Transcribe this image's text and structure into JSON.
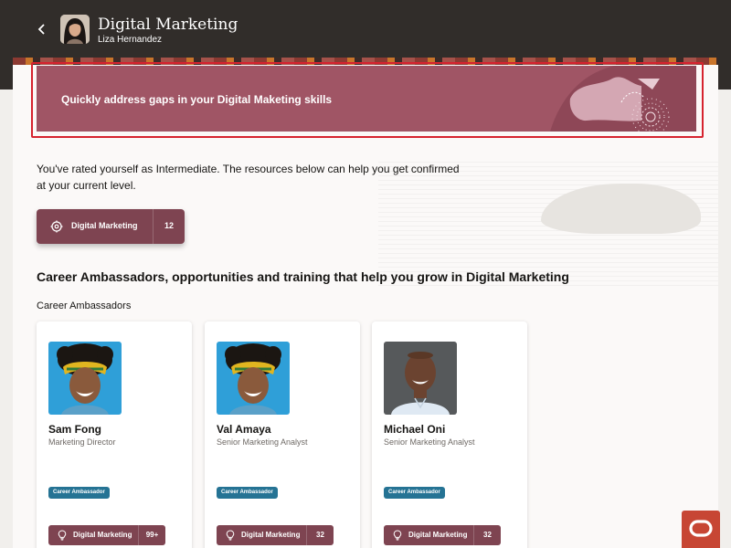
{
  "header": {
    "back_icon": "chevron-left-icon",
    "title": "Digital Marketing",
    "subtitle": "Liza Hernandez"
  },
  "banner": {
    "text": "Quickly address gaps in your Digital Maketing skills",
    "color": "#a05565"
  },
  "intro": {
    "text": "You've rated yourself as Intermediate. The resources below can help you get confirmed at your current level."
  },
  "skill_button": {
    "icon": "gear-icon",
    "label": "Digital Marketing",
    "count": "12"
  },
  "section": {
    "title": "Career Ambassadors, opportunities and training that help you grow in Digital Marketing",
    "subtitle": "Career Ambassadors"
  },
  "cards": [
    {
      "name": "Sam Fong",
      "role": "Marketing Director",
      "badge": "Career Ambassador",
      "chip_label": "Digital Marketing",
      "chip_count": "99+",
      "chip_icon": "lightbulb-icon"
    },
    {
      "name": "Val Amaya",
      "role": "Senior Marketing Analyst",
      "badge": "Career Ambassador",
      "chip_label": "Digital Marketing",
      "chip_count": "32",
      "chip_icon": "lightbulb-icon"
    },
    {
      "name": "Michael Oni",
      "role": "Senior Marketing Analyst",
      "badge": "Career Ambassador",
      "chip_label": "Digital Marketing",
      "chip_count": "32",
      "chip_icon": "lightbulb-icon"
    }
  ],
  "colors": {
    "header_bg": "#312d2a",
    "accent": "#7e4451",
    "badge": "#257394",
    "oracle": "#c74634"
  }
}
